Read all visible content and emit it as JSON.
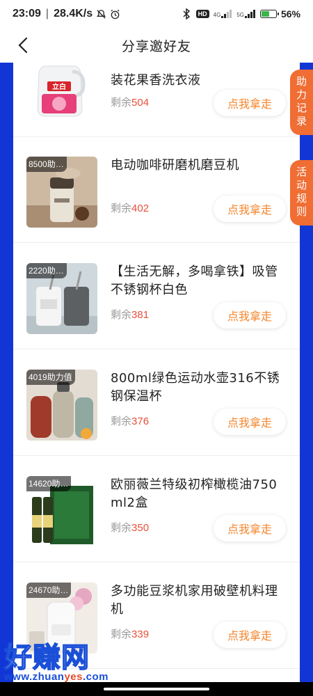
{
  "status_bar": {
    "time": "23:09",
    "speed": "28.4K/s",
    "hd_badge": "HD",
    "net_4g": "4G",
    "net_5g": "5G",
    "battery_level": 0.56,
    "battery_text": "56%"
  },
  "nav": {
    "title": "分享邀好友"
  },
  "side_tabs": {
    "help_record": "助力记录",
    "rules": "活动规则"
  },
  "items": [
    {
      "badge": "",
      "title": "装花果香洗衣液",
      "stock_label": "剩余",
      "stock": "504",
      "button": "点我拿走"
    },
    {
      "badge": "8500助…",
      "title": "电动咖啡研磨机磨豆机",
      "stock_label": "剩余",
      "stock": "402",
      "button": "点我拿走"
    },
    {
      "badge": "2220助…",
      "title": "【生活无解，多喝拿铁】吸管不锈钢杯白色",
      "stock_label": "剩余",
      "stock": "381",
      "button": "点我拿走"
    },
    {
      "badge": "4019助力值",
      "title": "800ml绿色运动水壶316不锈钢保温杯",
      "stock_label": "剩余",
      "stock": "376",
      "button": "点我拿走"
    },
    {
      "badge": "14620助…",
      "title": "欧丽薇兰特级初榨橄榄油750ml2盒",
      "stock_label": "剩余",
      "stock": "350",
      "button": "点我拿走"
    },
    {
      "badge": "24670助…",
      "title": "多功能豆浆机家用破壁机料理机",
      "stock_label": "剩余",
      "stock": "339",
      "button": "点我拿走"
    }
  ],
  "watermark": {
    "main": "好赚网",
    "url_prefix": "www.zhuan",
    "url_highlight": "yes",
    "url_suffix": ".com"
  },
  "colors": {
    "frame_blue": "#1236d6",
    "accent_orange": "#f06d33",
    "button_text": "#f5852b",
    "stock_red": "#e8503a"
  }
}
